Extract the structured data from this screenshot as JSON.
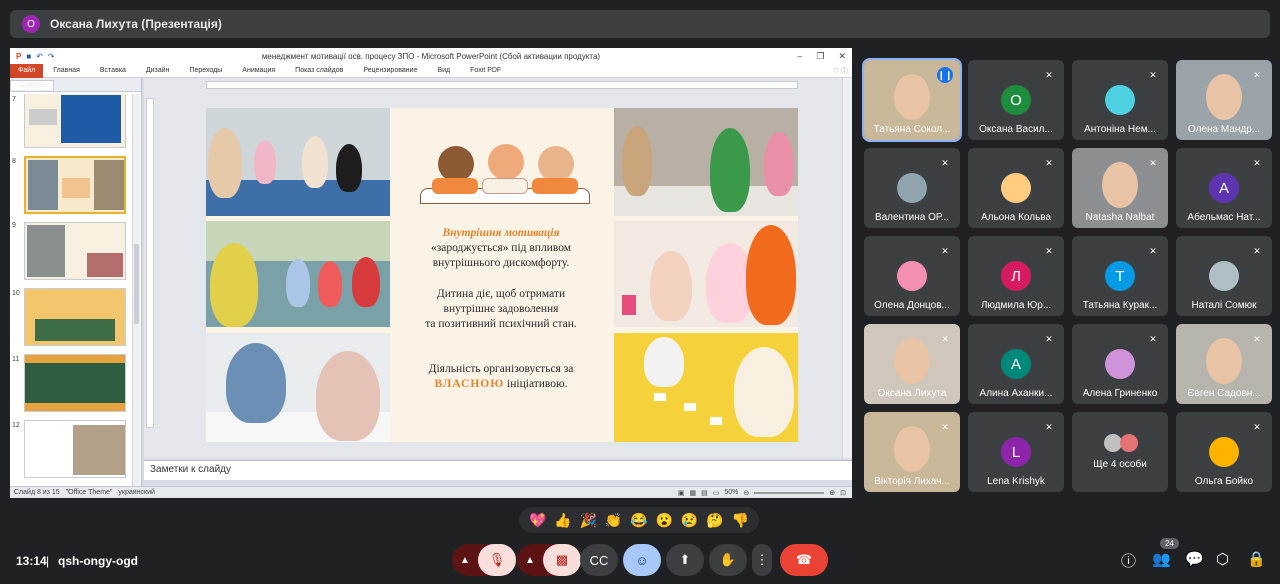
{
  "header": {
    "avatar_letter": "О",
    "title": "Оксана Лихута (Презентація)"
  },
  "ppt": {
    "window_title": "менеджмент мотивації осв. процесу ЗПО  -  Microsoft PowerPoint (Сбой активации продукта)",
    "tabs": [
      "Файл",
      "Главная",
      "Вставка",
      "Дизайн",
      "Переходы",
      "Анимация",
      "Показ слайдов",
      "Рецензирование",
      "Вид",
      "Foxit PDF"
    ],
    "panel_tabs": [
      "Слайды",
      "Структура"
    ],
    "slide_numbers": [
      "7",
      "8",
      "9",
      "10",
      "11",
      "12"
    ],
    "notes_placeholder": "Заметки к слайду",
    "status": {
      "slide": "Слайд 8 из 15",
      "theme": "\"Office Theme\"",
      "lang": "украинский",
      "zoom": "50%"
    },
    "slide": {
      "line1": "Внутрішня мотивація",
      "line2": "«зароджується» під впливом",
      "line3": "внутрішнього дискомфорту.",
      "line4": "Дитина діє, щоб отримати",
      "line5": "внутрішнє задоволення",
      "line6": "та позитивний психічний стан.",
      "line7": "Діяльність організовується за",
      "line8a": "ВЛАСНОЮ",
      "line8b": " ініціативою."
    }
  },
  "participants": [
    {
      "name": "Татьяна Сокол...",
      "letter": "",
      "color": "",
      "type": "photo"
    },
    {
      "name": "Оксана Васил...",
      "letter": "О",
      "color": "#1e8e3e",
      "type": "letter"
    },
    {
      "name": "Антоніна Нем...",
      "letter": "",
      "color": "#4dd0e1",
      "type": "avatar"
    },
    {
      "name": "Олена Мандр...",
      "letter": "",
      "color": "",
      "type": "photo"
    },
    {
      "name": "Валентина ОР...",
      "letter": "",
      "color": "#90a4ae",
      "type": "avatar"
    },
    {
      "name": "Альона Кольва",
      "letter": "",
      "color": "#ffcc80",
      "type": "avatar"
    },
    {
      "name": "Natasha Nalbat",
      "letter": "",
      "color": "",
      "type": "photo"
    },
    {
      "name": "Абельмас Нат...",
      "letter": "А",
      "color": "#5e35b1",
      "type": "letter"
    },
    {
      "name": "Олена Донцов...",
      "letter": "",
      "color": "#f48fb1",
      "type": "avatar"
    },
    {
      "name": "Людмила Юр...",
      "letter": "Л",
      "color": "#d81b60",
      "type": "letter"
    },
    {
      "name": "Татьяна Курак...",
      "letter": "Т",
      "color": "#039be5",
      "type": "letter"
    },
    {
      "name": "Наталі Сомюк",
      "letter": "",
      "color": "#b0bec5",
      "type": "avatar"
    },
    {
      "name": "Оксана Лихута",
      "letter": "",
      "color": "",
      "type": "photo"
    },
    {
      "name": "Алина Аханки...",
      "letter": "А",
      "color": "#00897b",
      "type": "letter"
    },
    {
      "name": "Алена Гриненко",
      "letter": "",
      "color": "#ce93d8",
      "type": "avatar"
    },
    {
      "name": "Євген Садовн...",
      "letter": "",
      "color": "",
      "type": "photo"
    },
    {
      "name": "Вікторія Лихач...",
      "letter": "",
      "color": "",
      "type": "photo"
    },
    {
      "name": "Lena Krishyk",
      "letter": "L",
      "color": "#8e24aa",
      "type": "letter"
    },
    {
      "name": "Ще 4 особи",
      "letter": "",
      "color": "",
      "type": "more"
    },
    {
      "name": "Ольга Бойко",
      "letter": "",
      "color": "#ffb300",
      "type": "avatar"
    }
  ],
  "reactions": [
    "💖",
    "👍",
    "🎉",
    "👏",
    "😂",
    "😮",
    "😢",
    "🤔",
    "👎"
  ],
  "bottom": {
    "time": "13:14",
    "separator": "|",
    "meeting_code": "qsh-ongy-ogd",
    "people_count": "24"
  }
}
